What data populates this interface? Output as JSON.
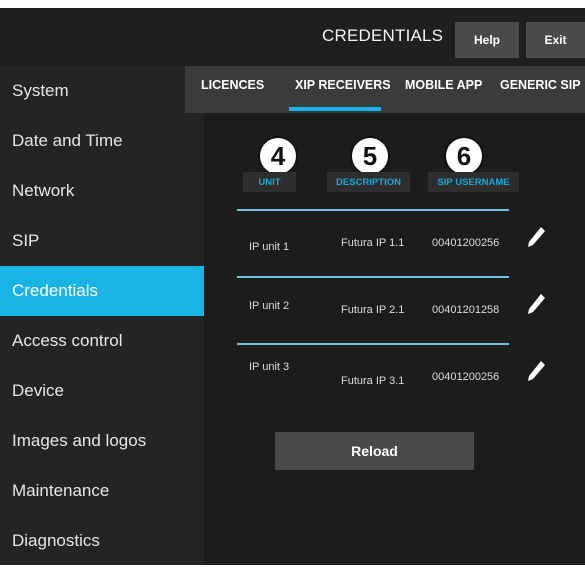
{
  "header": {
    "title": "CREDENTIALS",
    "help_label": "Help",
    "exit_label": "Exit"
  },
  "sidebar": {
    "items": [
      {
        "label": "System"
      },
      {
        "label": "Date and Time"
      },
      {
        "label": "Network"
      },
      {
        "label": "SIP"
      },
      {
        "label": "Credentials"
      },
      {
        "label": "Access control"
      },
      {
        "label": "Device"
      },
      {
        "label": "Images and logos"
      },
      {
        "label": "Maintenance"
      },
      {
        "label": "Diagnostics"
      }
    ],
    "active": "Credentials"
  },
  "tabs": [
    {
      "label": "LICENCES"
    },
    {
      "label": "XIP RECEIVERS"
    },
    {
      "label": "MOBILE APP"
    },
    {
      "label": "GENERIC SIP"
    }
  ],
  "active_tab": "XIP RECEIVERS",
  "callouts": [
    "4",
    "5",
    "6"
  ],
  "table": {
    "columns": [
      "UNIT",
      "DESCRIPTION",
      "SIP USERNAME"
    ],
    "rows": [
      {
        "unit": "IP unit 1",
        "description": "Futura IP 1.1",
        "sip_username": "00401200256"
      },
      {
        "unit": "IP unit 2",
        "description": "Futura IP 2.1",
        "sip_username": "00401201258"
      },
      {
        "unit": "IP unit 3",
        "description": "Futura IP 3.1",
        "sip_username": "00401200256"
      }
    ]
  },
  "reload_label": "Reload",
  "colors": {
    "accent": "#19b4e6",
    "background": "#1e1e1e",
    "button": "#4a4a4a"
  }
}
